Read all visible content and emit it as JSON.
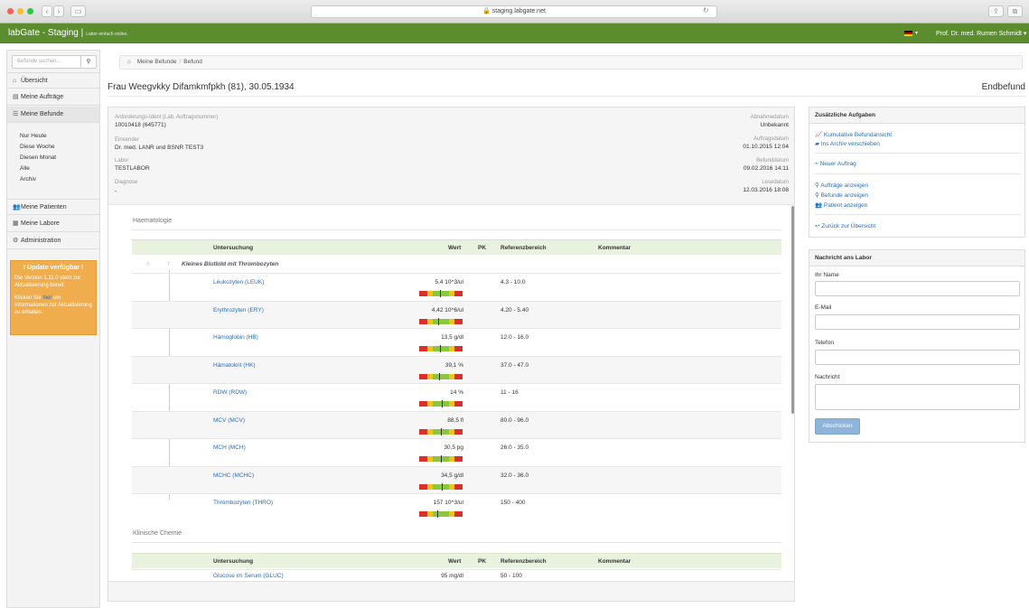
{
  "browser": {
    "url": "staging.labgate.net"
  },
  "navbar": {
    "brand": "labGate - Staging |",
    "tagline": "Labor einfach online.",
    "user": "Prof. Dr. med. Rumen Schmidt"
  },
  "sidebar": {
    "search_placeholder": "Befunde suchen...",
    "items": {
      "uebersicht": "Übersicht",
      "auftraege": "Meine Aufträge",
      "befunde": "Meine Befunde",
      "patienten": "Meine Patienten",
      "labore": "Meine Labore",
      "administration": "Administration"
    },
    "sub_items": [
      "Nur Heute",
      "Diese Woche",
      "Diesen Monat",
      "Alle",
      "Archiv"
    ],
    "update": {
      "title": "! Update verfügbar !",
      "text1": "Die Version 1.11.0 steht zur Aktualisierung bereit.",
      "text2a": "Klicken Sie",
      "link": "hier",
      "text2b": "um Informationen zur Aktualisierung zu erhalten."
    }
  },
  "breadcrumb": {
    "home": "⌂",
    "item1": "Meine Befunde",
    "item2": "Befund"
  },
  "patient": {
    "title": "Frau Weegvkky Difamkmfpkh (81), 30.05.1934",
    "status": "Endbefund"
  },
  "info": {
    "ident_label": "Anforderungs-Ident (Lab. Auftragsnummer)",
    "ident_value": "10010418 (645771)",
    "einsender_label": "Einsender",
    "einsender_value": "Dr. med. LANR und BSNR TEST3",
    "labor_label": "Labor",
    "labor_value": "TESTLABOR",
    "diagnose_label": "Diagnose",
    "diagnose_value": "-",
    "abnahme_label": "Abnahmedatum",
    "abnahme_value": "Unbekannt",
    "auftrag_label": "Auftragsdatum",
    "auftrag_value": "01.10.2015 12:04",
    "befund_label": "Befunddatum",
    "befund_value": "09.02.2016 14:11",
    "lese_label": "Lesedatum",
    "lese_value": "12.03.2016 18:08"
  },
  "table_headers": {
    "untersuchung": "Untersuchung",
    "wert": "Wert",
    "pk": "PK",
    "ref": "Referenzbereich",
    "kommentar": "Kommentar"
  },
  "haematologie": {
    "title": "Haematologie",
    "group": "Kleines Blutbild mit Thrombozyten",
    "rows": [
      {
        "name": "Leukozyten (LEUK)",
        "value": "5,4 10^3/ul",
        "ref": "4.3 - 10.0",
        "marker": 0.46
      },
      {
        "name": "Erythrozyten (ERY)",
        "value": "4,42 10^6/ul",
        "ref": "4.20 - 5.40",
        "marker": 0.34
      },
      {
        "name": "Hämoglobin (HB)",
        "value": "13,5 g/dl",
        "ref": "12.0 - 16.0",
        "marker": 0.44
      },
      {
        "name": "Hämatokrit (HK)",
        "value": "39,1 %",
        "ref": "37.0 - 47.0",
        "marker": 0.38
      },
      {
        "name": "RDW (RDW)",
        "value": "14 %",
        "ref": "11 - 16",
        "marker": 0.56
      },
      {
        "name": "MCV (MCV)",
        "value": "88,5 fl",
        "ref": "80.0 - 96.0",
        "marker": 0.52
      },
      {
        "name": "MCH (MCH)",
        "value": "30,5 pg",
        "ref": "26.0 - 35.0",
        "marker": 0.5
      },
      {
        "name": "MCHC (MCHC)",
        "value": "34,5 g/dl",
        "ref": "32.0 - 36.0",
        "marker": 0.58
      },
      {
        "name": "Thrombozyten (THRO)",
        "value": "157 10^3/ul",
        "ref": "150 - 400",
        "marker": 0.28
      }
    ]
  },
  "klinische_chemie": {
    "title": "Klinische Chemie",
    "rows": [
      {
        "name": "Glucose im Serum (GLUC)",
        "value": "95 mg/dl",
        "ref": "50 - 100"
      }
    ]
  },
  "tasks": {
    "title": "Zusätzliche Aufgaben",
    "kumulativ": "Kumulative Befundansicht",
    "archiv": "Ins Archiv verschieben",
    "neuer_auftrag": "Neuer Auftrag",
    "auftraege": "Aufträge anzeigen",
    "befunde": "Befunde anzeigen",
    "patient": "Patient anzeigen",
    "zurueck": "Zurück zur Übersicht"
  },
  "message": {
    "title": "Nachricht ans Labor",
    "name_label": "Ihr Name",
    "email_label": "E-Mail",
    "telefon_label": "Telefon",
    "nachricht_label": "Nachricht",
    "submit": "Abschicken"
  }
}
